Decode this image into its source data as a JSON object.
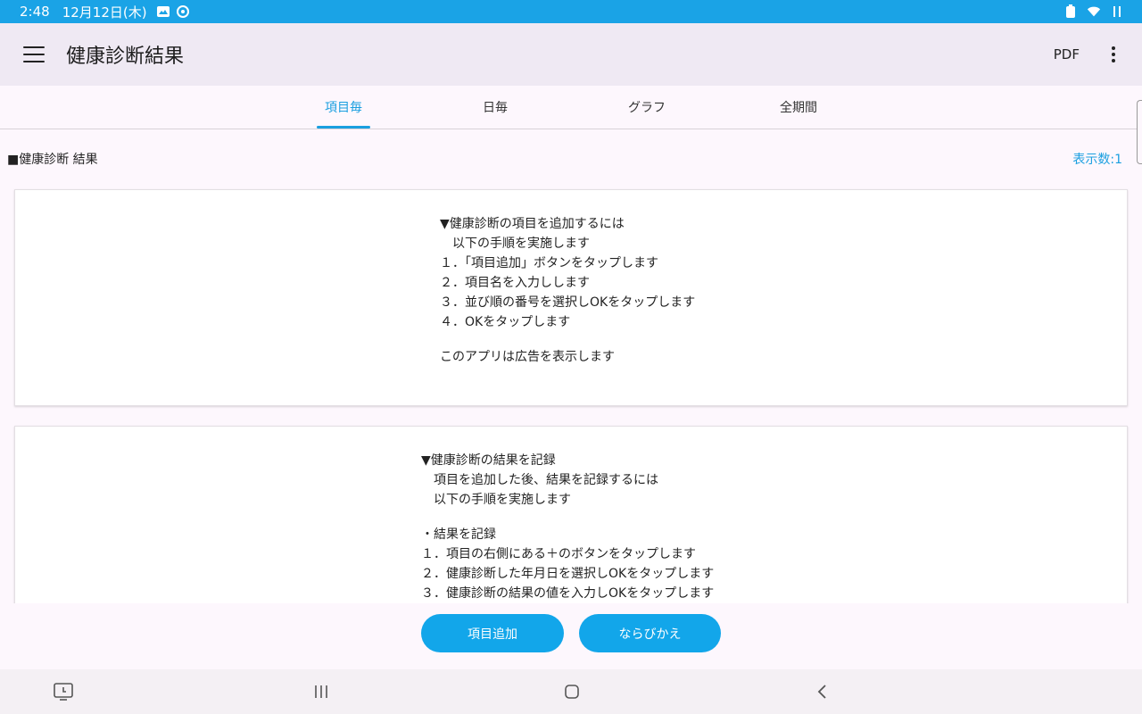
{
  "status_bar": {
    "time": "2:48",
    "date": "12月12日(木)",
    "icons": [
      "image-icon",
      "sync-icon",
      "battery-saver-icon",
      "wifi-icon",
      "data-icon"
    ]
  },
  "app_bar": {
    "title": "健康診断結果",
    "pdf_label": "PDF",
    "icons": [
      "menu-icon",
      "more-vert-icon"
    ]
  },
  "tabs": [
    {
      "label": "項目毎",
      "active": true
    },
    {
      "label": "日毎",
      "active": false
    },
    {
      "label": "グラフ",
      "active": false
    },
    {
      "label": "全期間",
      "active": false
    }
  ],
  "section": {
    "title": "■健康診断 結果",
    "count_label": "表示数:1"
  },
  "cards": [
    {
      "lines": [
        "▼健康診断の項目を追加するには",
        "　以下の手順を実施します",
        "１．「項目追加」ボタンをタップします",
        "２．項目名を入力しします",
        "３．並び順の番号を選択しOKをタップします",
        "４．OKをタップします"
      ],
      "footer": "このアプリは広告を表示します"
    },
    {
      "lines": [
        "▼健康診断の結果を記録",
        "　項目を追加した後、結果を記録するには",
        "　以下の手順を実施します"
      ],
      "lines2": [
        "・結果を記録",
        "１．項目の右側にある＋のボタンをタップします",
        "２．健康診断した年月日を選択しOKをタップします",
        "３．健康診断の結果の値を入力しOKをタップします"
      ]
    }
  ],
  "buttons": {
    "add_item": "項目追加",
    "sort": "ならびかえ"
  },
  "colors": {
    "accent": "#1a9fe0",
    "status_bar": "#1aa3e6",
    "button": "#12a6ea"
  },
  "nav_icons": [
    "screenshot-icon",
    "recent-apps-icon",
    "home-icon",
    "back-icon"
  ]
}
